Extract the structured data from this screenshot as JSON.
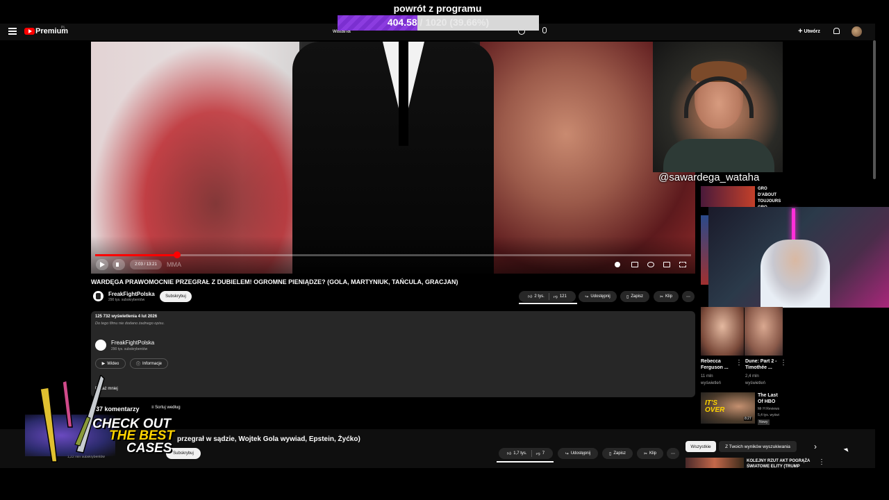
{
  "overlay": {
    "title": "powrót z programu",
    "current": "404.58",
    "rest": " / 1020 (39.66%)",
    "progress_fraction": 0.3966
  },
  "header": {
    "brand": "Premium",
    "region": "PL",
    "search_value": "wataha",
    "create_label": "Utwórz"
  },
  "player": {
    "time": "2:03 / 13:21",
    "watermark": "MMA",
    "seek_fraction": 0.137
  },
  "webcam": {
    "handle": "@sawardega_wataha"
  },
  "video": {
    "title": "WARDĘGA PRAWOMOCNIE PRZEGRAŁ Z DUBIELEM! OGROMNE PIENIĄDZE? (GOLA, MARTYNIUK, TAŃCULA, GRACJAN)",
    "channel": "FreakFightPolska",
    "subscribers": "290 tys. subskrybentów",
    "subscribe_label": "Subskrybuj",
    "actions": {
      "likes": "2 tys.",
      "dislikes": "121",
      "share": "Udostępnij",
      "save": "Zapisz",
      "clip": "Klip"
    }
  },
  "description": {
    "meta": "125 732 wyświetlenia  4 lut 2026",
    "empty": "Do tego filmu nie dodano żadnego opisu.",
    "channel": "FreakFightPolska",
    "subscribers": "290 tys. subskrybentów",
    "videos_label": "Wideo",
    "about_label": "Informacje",
    "show_less": "Pokaż mniej"
  },
  "comments": {
    "count_label": "437 komentarzy",
    "sort_label": "Sortuj według"
  },
  "sidebar": {
    "top_item_title": "GRO D'ABOUT TOUJOURS GRO D'ABOUT",
    "items": [
      {
        "title": "Rebecca Ferguson ...",
        "meta1": "11 mln",
        "meta2": "wyświetleń"
      },
      {
        "title": "Dune: Part 2 - Timothée ...",
        "meta1": "2,4 mln",
        "meta2": "wyświetleń"
      }
    ],
    "over_item": {
      "thumb_text": "IT'S OVER",
      "duration": "8:27",
      "title": "The Last Of HBO",
      "channel": "Mr H Reviews",
      "meta": "5,4 tys. wyświ",
      "badge": "Nowy"
    }
  },
  "miniplayer": {
    "title": "przegrał w sądzie, Wojtek Gola wywiad, Epstein, Żyćko)",
    "subscribe_label": "Subskrybuj",
    "subscribers": "1,22 mln subskrybentów",
    "likes": "1,7 tys.",
    "dislikes": "7",
    "share": "Udostępnij",
    "save": "Zapisz",
    "clip": "Klip"
  },
  "chips": {
    "all": "Wszystkie",
    "related": "Z Twoich wyników wyszukiwania"
  },
  "next_video": {
    "title": "KOLEJNY RZUT AKT POGRĄŻA ŚWIATOWE ELITY (TRUMP"
  },
  "ad": {
    "line1": "CHECK OUT",
    "line2": "THE BEST",
    "line3": "CASES"
  },
  "colors": {
    "accent": "#ff0000",
    "progress": "#7b2fd0",
    "background": "#0f0f0f"
  }
}
